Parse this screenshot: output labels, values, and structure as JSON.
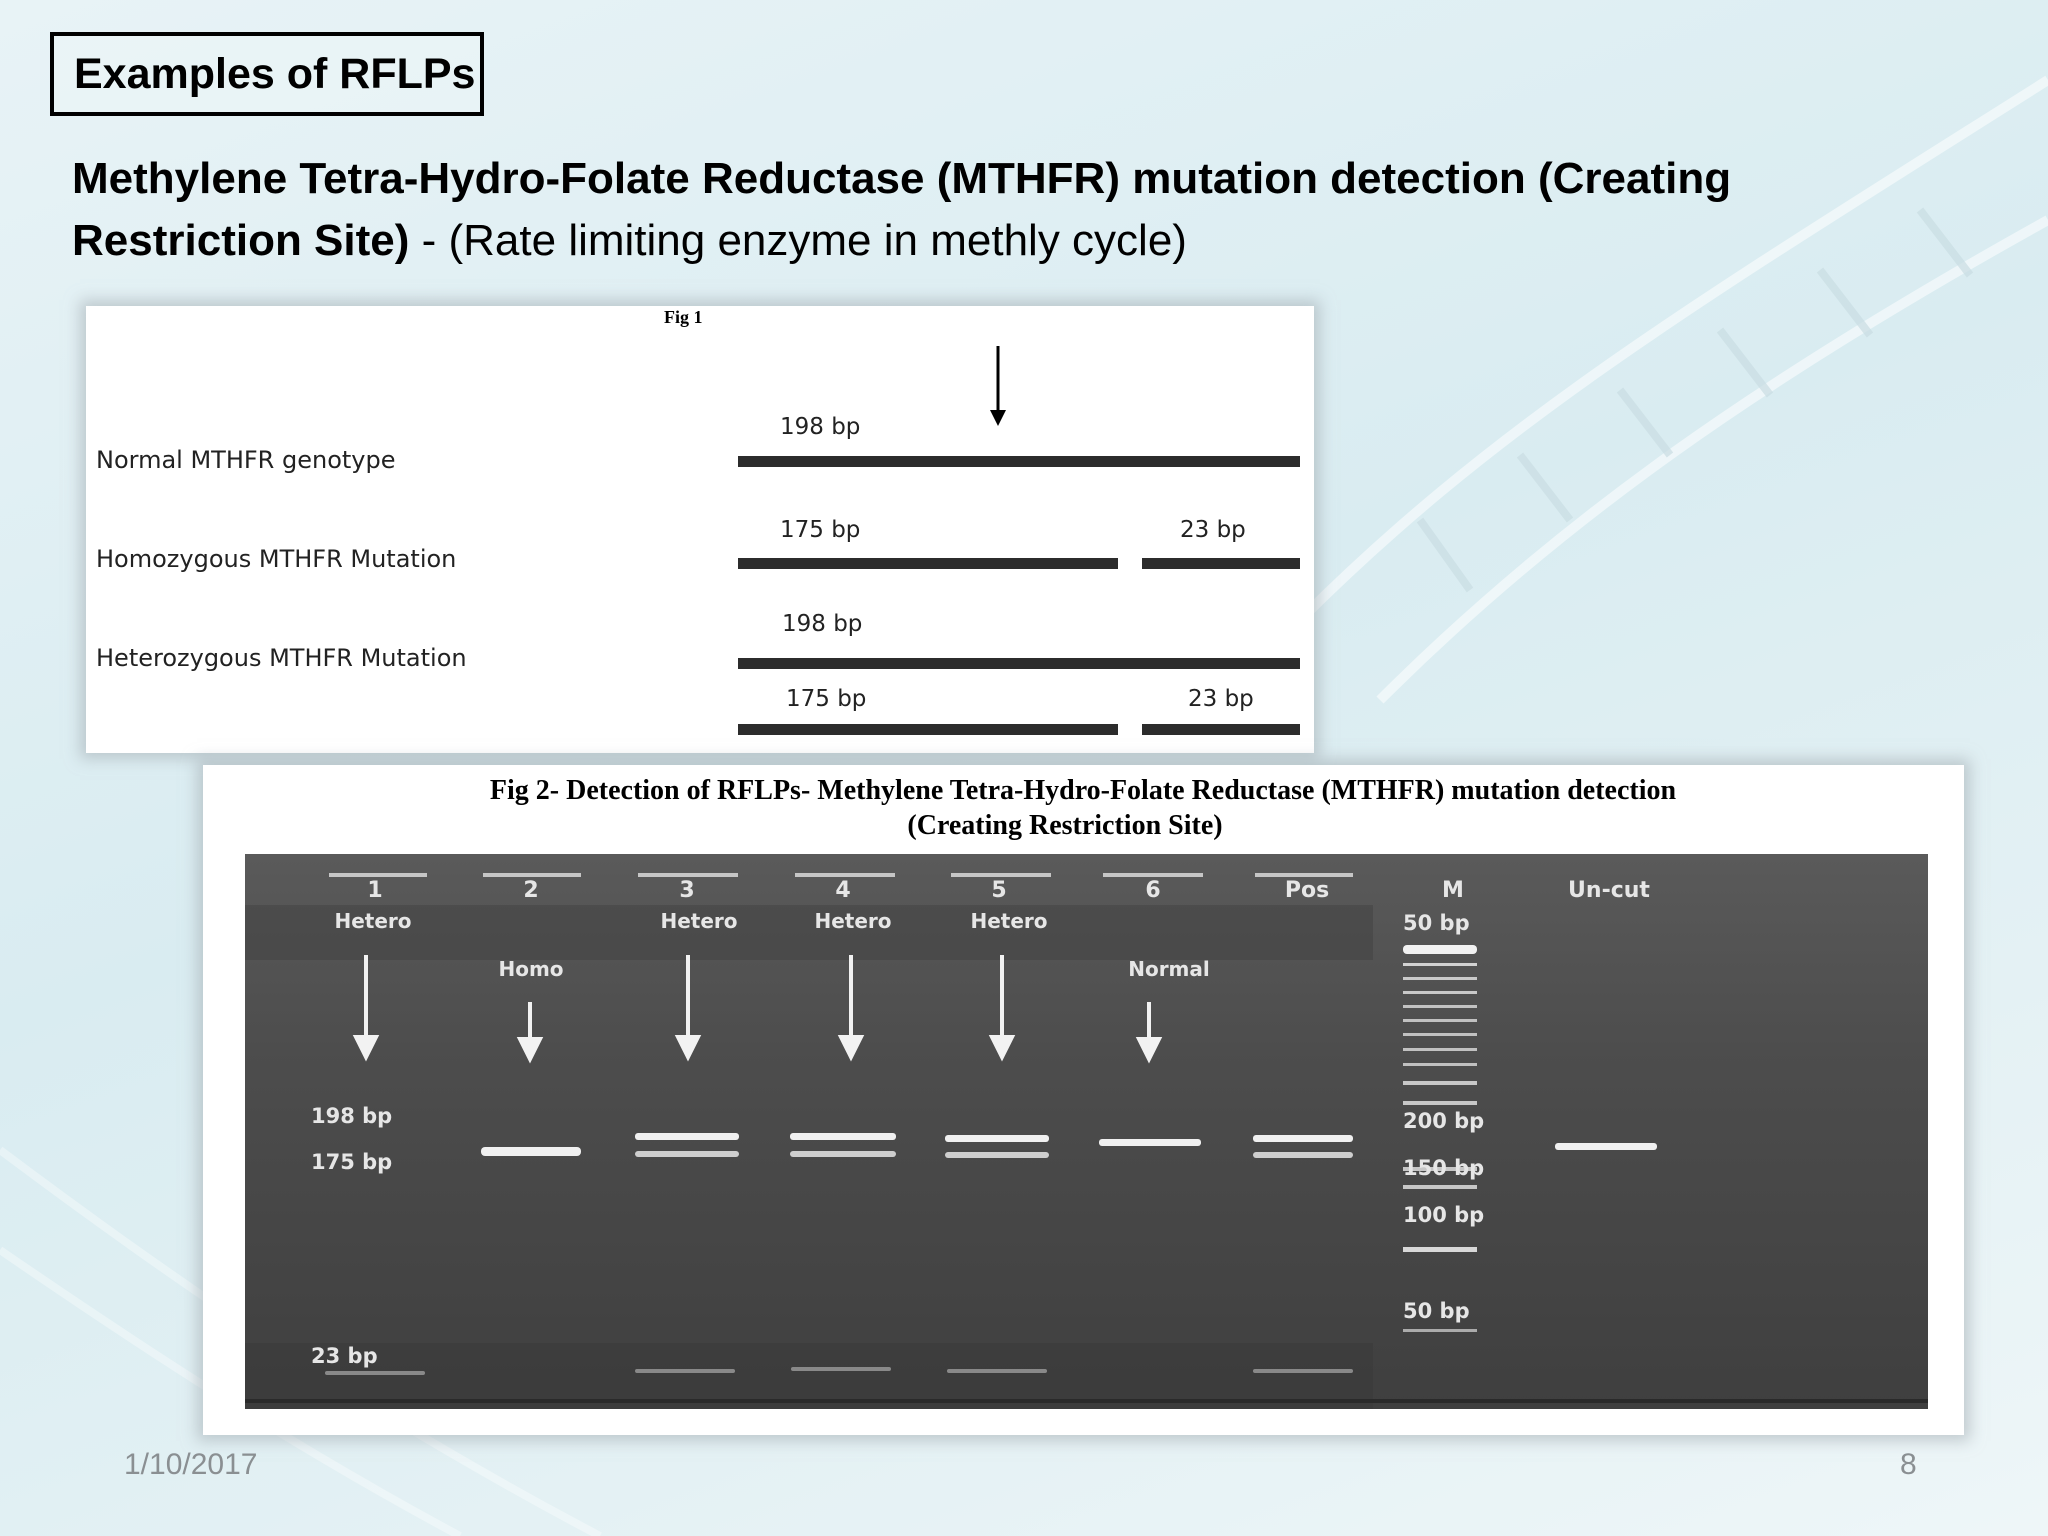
{
  "slide": {
    "title": "Examples of RFLPs",
    "heading_bold": "Methylene Tetra-Hydro-Folate Reductase (MTHFR) mutation detection (Creating Restriction Site)",
    "heading_sep": " - ",
    "heading_normal": "(Rate limiting enzyme in methly cycle)",
    "date": "1/10/2017",
    "page_number": "8"
  },
  "fig1": {
    "caption": "Fig 1",
    "rows": [
      {
        "label": "Normal MTHFR genotype",
        "fragments": [
          "198 bp"
        ]
      },
      {
        "label": "Homozygous MTHFR Mutation",
        "fragments": [
          "175 bp",
          "23 bp"
        ]
      },
      {
        "label": "Heterozygous MTHFR Mutation",
        "fragments": [
          "198 bp",
          "175 bp",
          "23 bp"
        ]
      }
    ]
  },
  "fig2": {
    "title_line1": "Fig 2- Detection of RFLPs- Methylene Tetra-Hydro-Folate Reductase (MTHFR) mutation detection",
    "title_line2": "(Creating Restriction Site)",
    "lanes": [
      {
        "number": "1",
        "genotype": "Hetero"
      },
      {
        "number": "2",
        "genotype": "Homo"
      },
      {
        "number": "3",
        "genotype": "Hetero"
      },
      {
        "number": "4",
        "genotype": "Hetero"
      },
      {
        "number": "5",
        "genotype": "Hetero"
      },
      {
        "number": "6",
        "genotype": "Normal"
      },
      {
        "number": "Pos",
        "genotype": ""
      },
      {
        "number": "M",
        "genotype": ""
      },
      {
        "number": "Un-cut",
        "genotype": ""
      }
    ],
    "band_labels_left": [
      "198 bp",
      "175 bp",
      "23 bp"
    ],
    "marker_labels": [
      "50 bp",
      "200 bp",
      "150 bp",
      "100 bp",
      "50 bp"
    ]
  }
}
